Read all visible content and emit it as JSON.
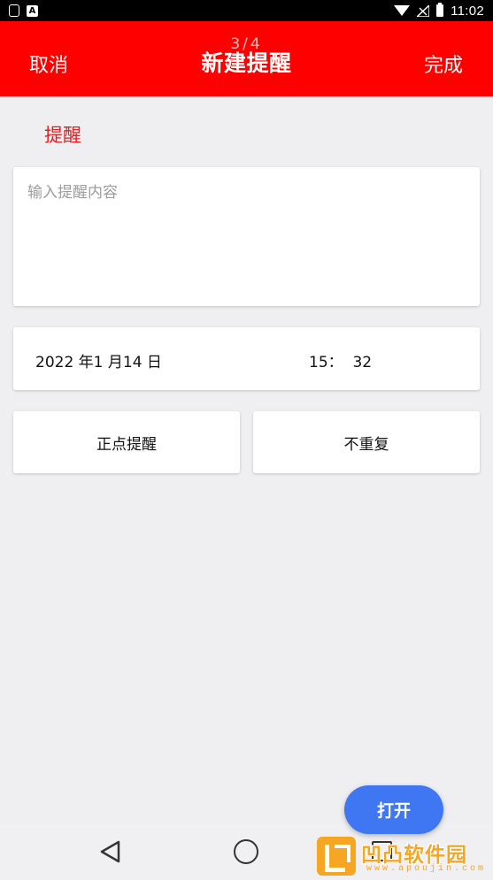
{
  "status_bar": {
    "time": "11:02",
    "icons": [
      "clipboard-icon",
      "a-badge-icon",
      "wifi-icon",
      "signal-icon",
      "battery-icon"
    ]
  },
  "header": {
    "cancel_label": "取消",
    "title": "新建提醒",
    "page_indicator": "3/4",
    "done_label": "完成",
    "background_color": "#fe0000"
  },
  "reminder": {
    "section_label": "提醒",
    "content_placeholder": "输入提醒内容",
    "content_value": "",
    "date": "2022 年1 月14 日",
    "time": "15：  32",
    "alert_option": "正点提醒",
    "repeat_option": "不重复"
  },
  "floating_button": {
    "label": "打开",
    "color": "#3f76f2"
  },
  "nav_bar": {
    "icons": [
      "back-triangle-icon",
      "home-circle-icon",
      "recents-square-icon"
    ]
  },
  "watermark": {
    "text": "凹凸软件园",
    "url": "www.apoujin.com",
    "color": "#f5a623"
  }
}
